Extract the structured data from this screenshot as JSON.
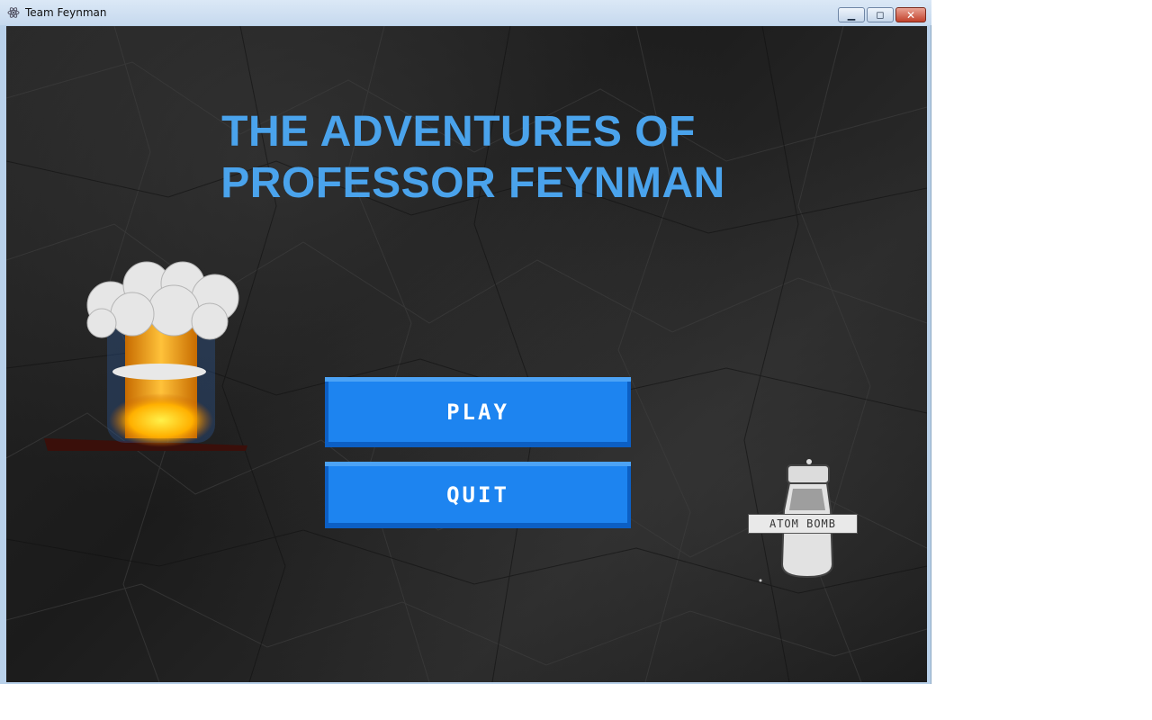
{
  "window": {
    "title": "Team Feynman",
    "icon": "atom-icon",
    "controls": [
      "minimize-icon",
      "maximize-icon",
      "close-icon"
    ]
  },
  "game": {
    "title_line1": "THE ADVENTURES OF",
    "title_line2": "PROFESSOR FEYNMAN",
    "menu": {
      "play_label": "PLAY",
      "quit_label": "QUIT"
    },
    "decorations": {
      "left": "mushroom-cloud-icon",
      "right": "atom-bomb-icon",
      "bomb_label": "ATOM BOMB"
    }
  },
  "colors": {
    "title": "#4aa3ec",
    "button": "#1d84f0",
    "background": "#222222"
  }
}
